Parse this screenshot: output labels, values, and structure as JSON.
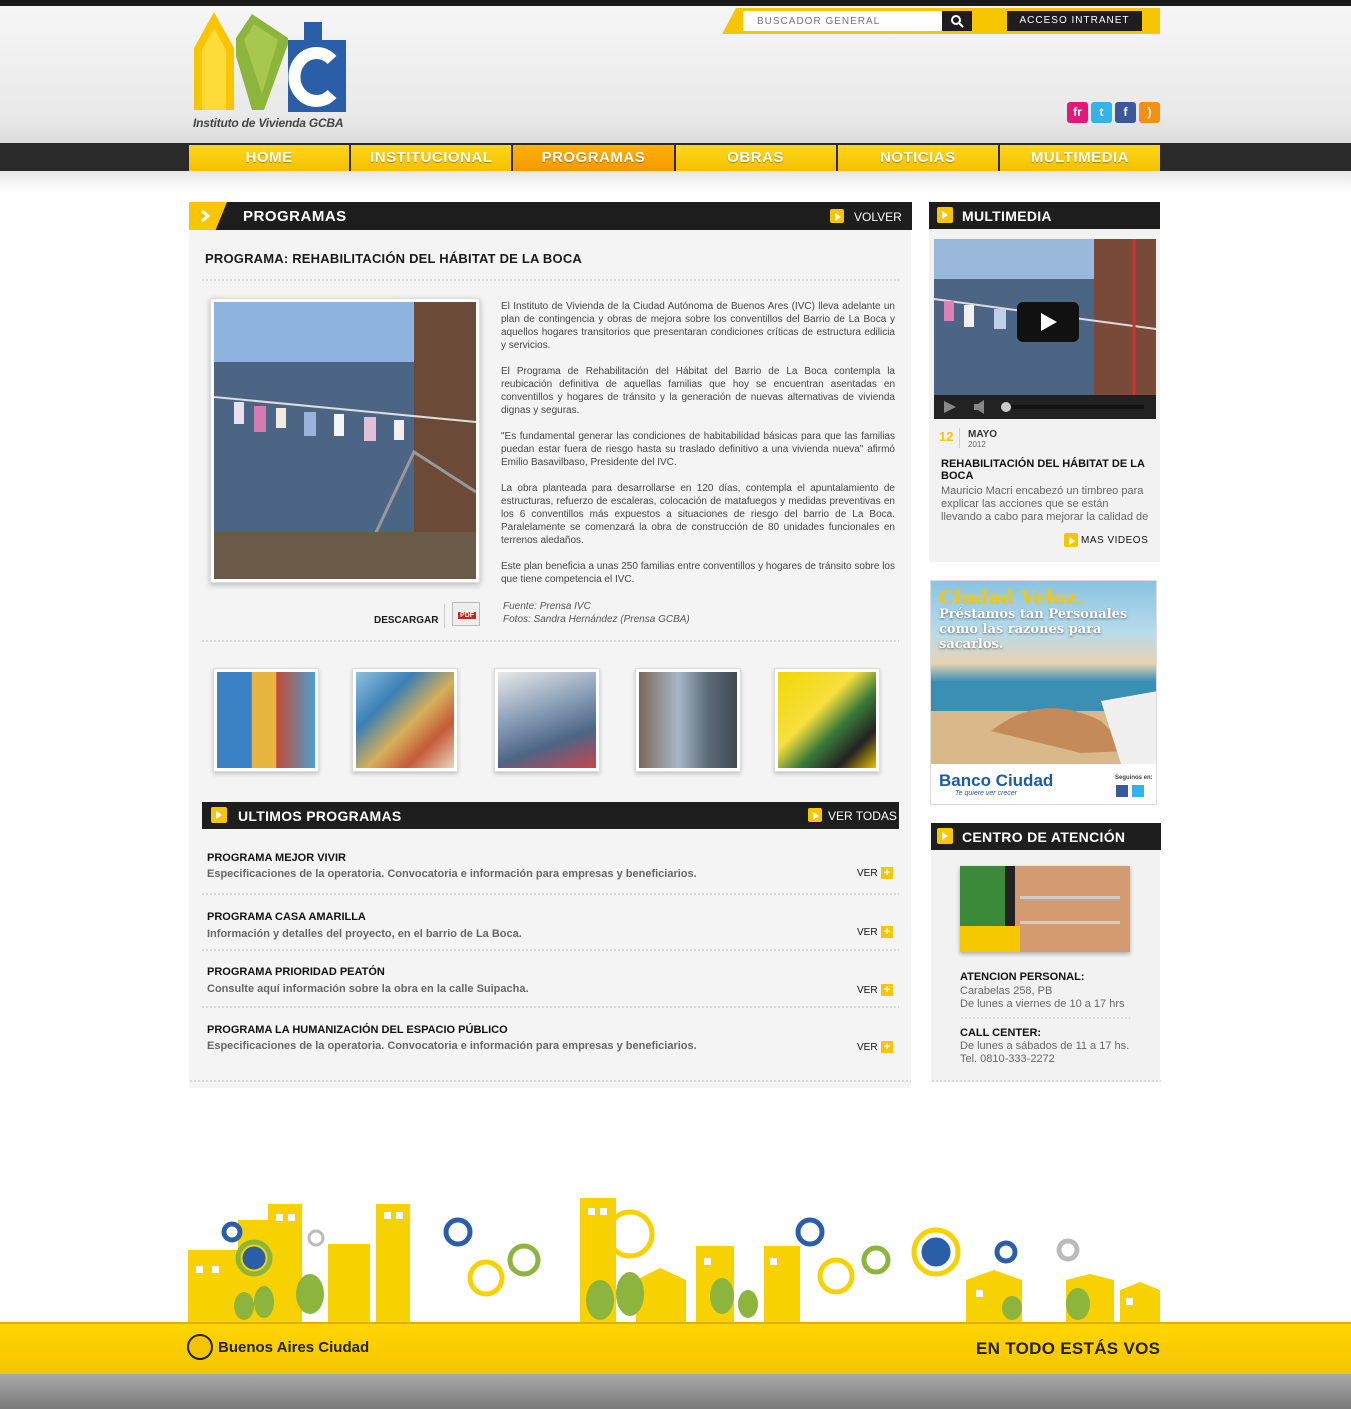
{
  "header": {
    "logo_text": "IVC",
    "logo_tagline": "Instituto de Vivienda GCBA",
    "search_placeholder": "BUSCADOR GENERAL",
    "intranet_label": "ACCESO INTRANET",
    "social": [
      {
        "icon": "flickr-icon",
        "glyph": "fr",
        "color": "#e0197b"
      },
      {
        "icon": "twitter-icon",
        "glyph": "t",
        "color": "#35b3e8"
      },
      {
        "icon": "facebook-icon",
        "glyph": "f",
        "color": "#3b5998"
      },
      {
        "icon": "rss-icon",
        "glyph": ")",
        "color": "#f29111"
      }
    ]
  },
  "nav": {
    "items": [
      "HOME",
      "INSTITUCIONAL",
      "PROGRAMAS",
      "OBRAS",
      "NOTICIAS",
      "MULTIMEDIA"
    ],
    "active": "PROGRAMAS"
  },
  "main": {
    "section_title": "PROGRAMAS",
    "back_label": "VOLVER",
    "article_title": "PROGRAMA: REHABILITACIÓN DEL HÁBITAT DE LA BOCA",
    "paragraphs": [
      "El Instituto de Vivienda de la Ciudad Autónoma de Buenos Ares (IVC) lleva adelante un plan de contingencia y obras de mejora sobre los conventillos del Barrio de La Boca y aquellos hogares transitorios que presentaran condiciones críticas de estructura edilicia y servicios.",
      "El Programa de Rehabilitación del Hábitat del Barrio de La Boca contempla la reubicación definitiva de aquellas familias que hoy se encuentran asentadas en conventillos y hogares de tránsito y la generación de nuevas alternativas de vivienda dignas y seguras.",
      "\"Es fundamental generar las condiciones de habitabilidad básicas para que las familias puedan estar fuera de riesgo hasta su traslado definitivo a una vivienda nueva\" afirmó Emilio Basavilbaso, Presidente del IVC.",
      "La obra planteada para desarrollarse en 120 días, contempla el apuntalamiento de estructuras, refuerzo de escaleras, colocación de matafuegos y medidas preventivas en los 6 conventillos más expuestos a situaciones de riesgo del barrio de La Boca. Paralelamente se comenzará la obra de construcción de 80 unidades funcionales en terrenos aledaños.",
      "Este plan beneficia a unas 250 familias entre conventillos y hogares de tránsito sobre los que tiene competencia el IVC."
    ],
    "source_line1": "Fuente: Prensa IVC",
    "source_line2": "Fotos: Sandra Hernández (Prensa GCBA)",
    "download_label": "DESCARGAR",
    "pdf_label": "PDF",
    "latest_title": "ULTIMOS PROGRAMAS",
    "see_all_label": "VER TODAS",
    "ver_label": "VER",
    "programs": [
      {
        "title": "PROGRAMA MEJOR VIVIR",
        "desc": "Especificaciones de la operatoria. Convocatoria e información para empresas y beneficiarios."
      },
      {
        "title": "PROGRAMA CASA AMARILLA",
        "desc": "Información y detalles del proyecto, en el barrio de La Boca."
      },
      {
        "title": "PROGRAMA PRIORIDAD PEATÓN",
        "desc": "Consulte aquí información sobre la obra en la calle Suipacha."
      },
      {
        "title": "PROGRAMA LA HUMANIZACIÓN DEL ESPACIO PÚBLICO",
        "desc": "Especificaciones de la operatoria. Convocatoria e información para empresas y beneficiarios."
      }
    ]
  },
  "sidebar": {
    "multimedia_title": "MULTIMEDIA",
    "video_day": "12",
    "video_month": "MAYO",
    "video_year": "2012",
    "video_title": "REHABILITACIÓN DEL HÁBITAT DE LA BOCA",
    "video_desc": "Mauricio Macri encabezó un timbreo para explicar las acciones que se están llevando a cabo para mejorar la calidad de",
    "more_videos_label": "MAS VIDEOS",
    "ad": {
      "title": "Ciudad Veloz.",
      "subtitle": "Préstamos tan Personales como las razones para sacarlos.",
      "bank": "Banco Ciudad",
      "tagline": "Te quiere ver crecer",
      "follow": "Seguinos en:"
    },
    "center_title": "CENTRO DE ATENCIÓN",
    "personal_label": "ATENCION PERSONAL:",
    "personal_line1": "Carabelas 258, PB",
    "personal_line2": "De lunes a viernes de 10 a 17 hrs",
    "callcenter_label": "CALL CENTER:",
    "callcenter_line1": "De lunes a sábados de 11 a 17 hs.",
    "callcenter_line2": "Tel. 0810-333-2272"
  },
  "footer": {
    "city_label": "Buenos Aires Ciudad",
    "slogan": "EN TODO ESTÁS VOS"
  },
  "colors": {
    "accent": "#f7c600",
    "active_nav": "#f59800",
    "dark": "#1e1e1e"
  }
}
